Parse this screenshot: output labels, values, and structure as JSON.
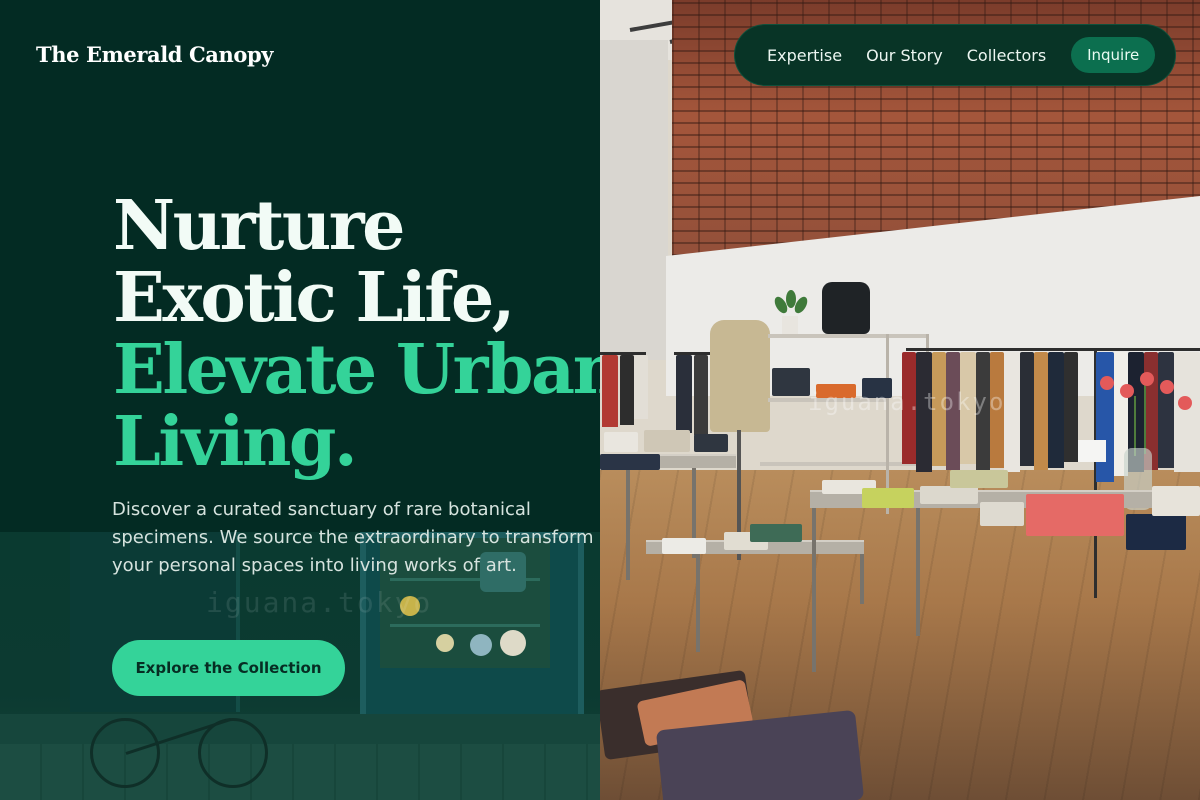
{
  "brand": {
    "name": "The Emerald Canopy"
  },
  "nav": {
    "links": [
      "Expertise",
      "Our Story",
      "Collectors"
    ],
    "cta_label": "Inquire"
  },
  "hero": {
    "headline_white": [
      "Nurture",
      "Exotic Life,"
    ],
    "headline_green": [
      "Elevate Urban",
      "Living."
    ],
    "description": "Discover a curated sanctuary of rare botanical specimens. We source the extraordinary to transform your personal spaces into living works of art.",
    "cta_label": "Explore the Collection"
  },
  "photo_watermarks": {
    "storefront": "iguana.tokyo",
    "interior": "iguana.tokyo"
  },
  "colors": {
    "background": "#032b23",
    "accent": "#34d399",
    "nav_background": "#083426",
    "nav_button": "#0c6f4f"
  }
}
